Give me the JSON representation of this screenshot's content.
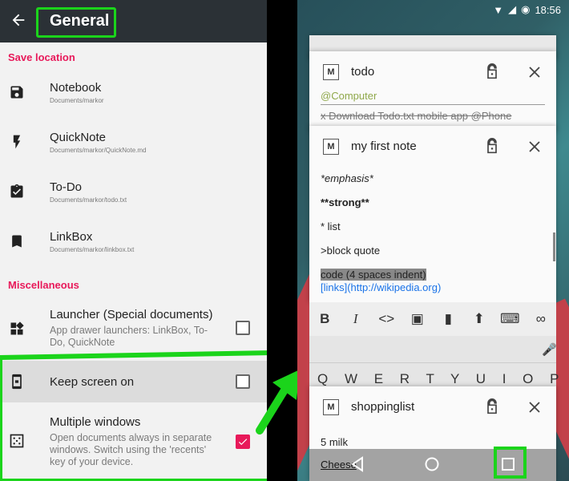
{
  "left": {
    "title": "General",
    "sections": {
      "save": "Save location",
      "misc": "Miscellaneous"
    },
    "items": [
      {
        "title": "Notebook",
        "sub": "Documents/markor"
      },
      {
        "title": "QuickNote",
        "sub": "Documents/markor/QuickNote.md"
      },
      {
        "title": "To-Do",
        "sub": "Documents/markor/todo.txt"
      },
      {
        "title": "LinkBox",
        "sub": "Documents/markor/linkbox.txt"
      }
    ],
    "launcher": {
      "title": "Launcher (Special documents)",
      "desc": "App drawer launchers: LinkBox, To-Do, QuickNote",
      "checked": false
    },
    "keep": {
      "title": "Keep screen on",
      "checked": false
    },
    "multi": {
      "title": "Multiple windows",
      "desc": "Open documents always in separate windows. Switch using the 'recents' key of your device.",
      "checked": true
    }
  },
  "right": {
    "status": {
      "time": "18:56"
    },
    "cards": [
      {
        "name": "todo",
        "lines": [
          "@Computer",
          "x Download Todo.txt mobile app @Phone"
        ]
      },
      {
        "name": "my first note",
        "lines": [
          "*emphasis*",
          "**strong**",
          "* list",
          ">block quote",
          "    code (4 spaces indent)",
          "[links](http://wikipedia.org)"
        ]
      },
      {
        "name": "shoppinglist",
        "lines": [
          "5 milk",
          "Cheese"
        ]
      }
    ],
    "keyboard_row": "Q W E R T Y U I O P"
  },
  "colors": {
    "accent": "#e8195a",
    "highlight": "#1bd41b",
    "topbar": "#2b3136"
  }
}
